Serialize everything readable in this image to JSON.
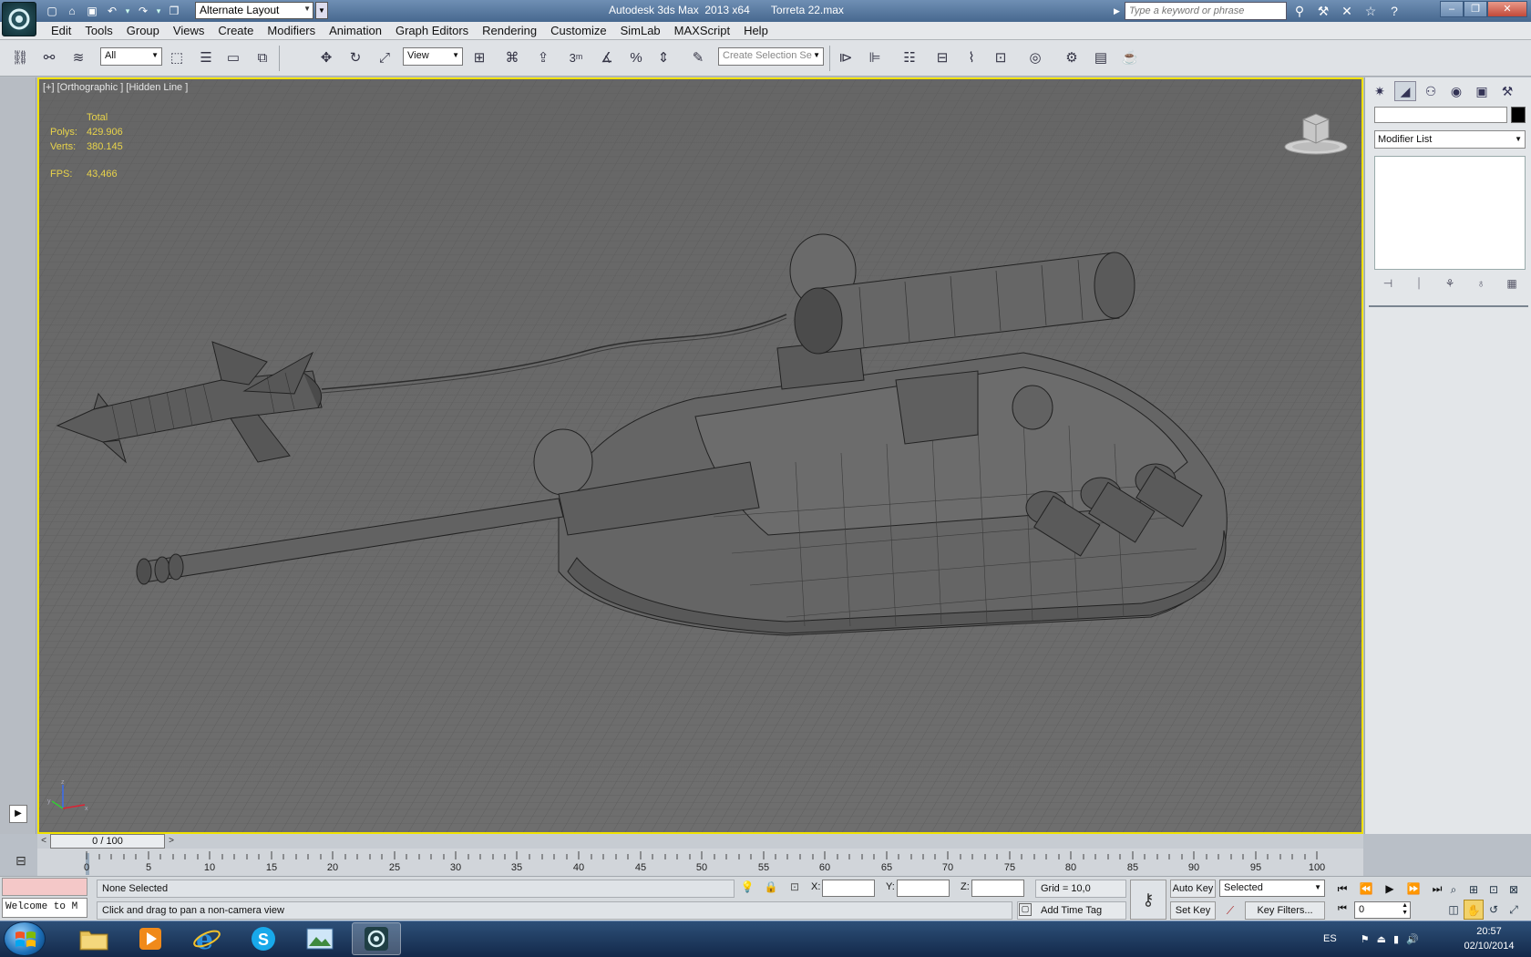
{
  "window": {
    "app_title": "Autodesk 3ds Max  2013 x64",
    "file_name": "Torreta 22.max",
    "workspace": "Alternate Layout",
    "search_placeholder": "Type a keyword or phrase"
  },
  "menu": [
    "Edit",
    "Tools",
    "Group",
    "Views",
    "Create",
    "Modifiers",
    "Animation",
    "Graph Editors",
    "Rendering",
    "Customize",
    "SimLab",
    "MAXScript",
    "Help"
  ],
  "toolbar": {
    "selection_filter": "All",
    "reference_coord": "View",
    "snap_number": "3",
    "named_selection_placeholder": "Create Selection Se"
  },
  "viewport": {
    "label": "[+] [Orthographic ] [Hidden Line ]",
    "stats": {
      "header": "Total",
      "polys_label": "Polys:",
      "polys_value": "429.906",
      "verts_label": "Verts:",
      "verts_value": "380.145",
      "fps_label": "FPS:",
      "fps_value": "43,466"
    },
    "border_color": "#f0e100"
  },
  "command_panel": {
    "modifier_list": "Modifier List"
  },
  "time_slider": {
    "position": "0 / 100"
  },
  "track_bar": {
    "ticks": [
      "0",
      "5",
      "10",
      "15",
      "20",
      "25",
      "30",
      "35",
      "40",
      "45",
      "50",
      "55",
      "60",
      "65",
      "70",
      "75",
      "80",
      "85",
      "90",
      "95",
      "100"
    ]
  },
  "status": {
    "listener_text": "Welcome to M",
    "selection": "None Selected",
    "prompt": "Click and drag to pan a non-camera view",
    "x_label": "X:",
    "y_label": "Y:",
    "z_label": "Z:",
    "grid": "Grid = 10,0",
    "add_time_tag": "Add Time Tag",
    "auto_key": "Auto Key",
    "set_key": "Set Key",
    "key_mode": "Selected",
    "key_filters": "Key Filters...",
    "current_frame": "0"
  },
  "taskbar": {
    "language": "ES",
    "time": "20:57",
    "date": "02/10/2014"
  }
}
